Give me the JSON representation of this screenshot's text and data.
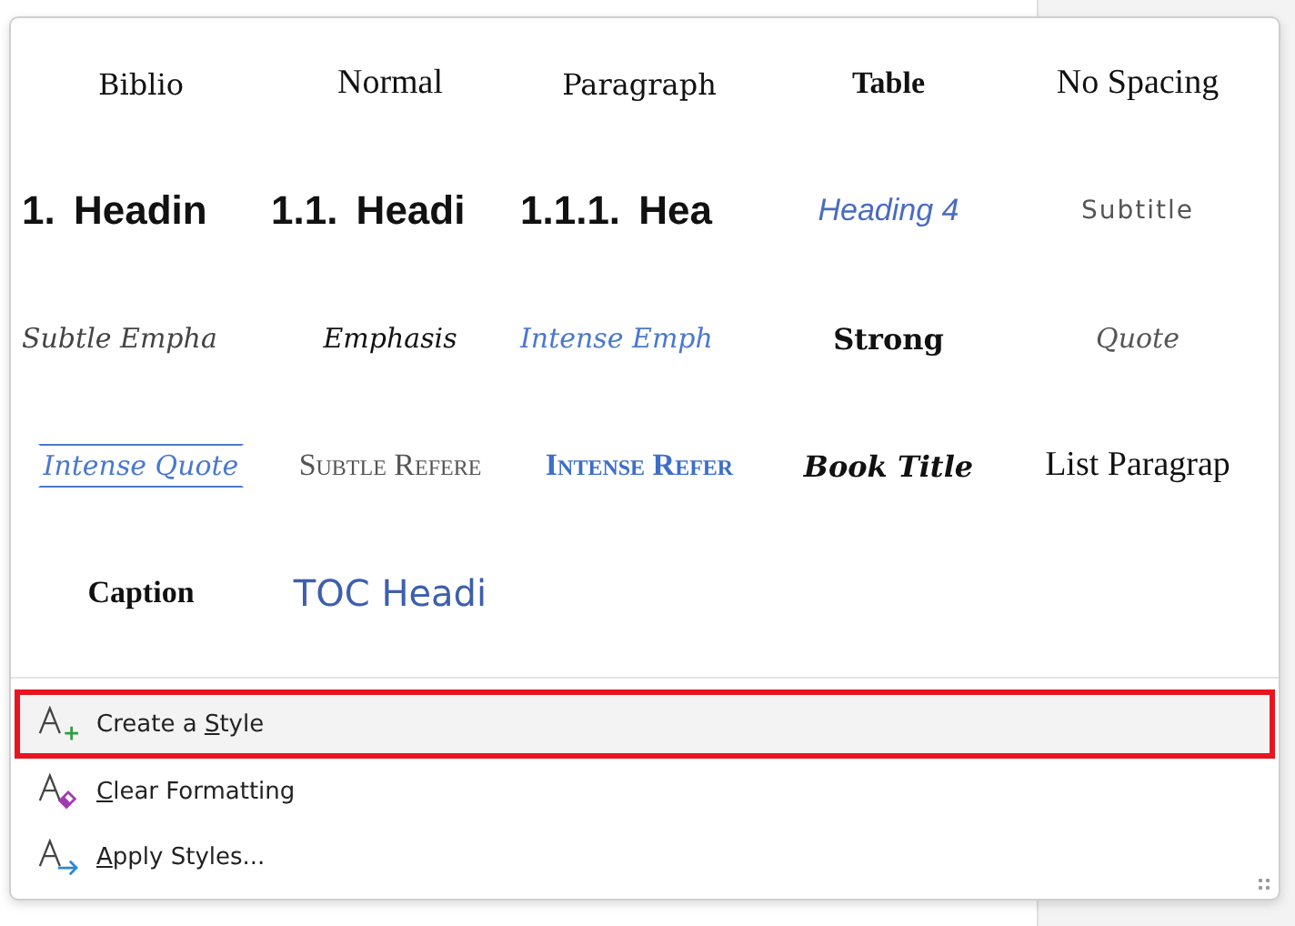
{
  "styles": [
    {
      "label": "Biblio",
      "kind": "plain",
      "selected": false
    },
    {
      "label": "Normal",
      "kind": "serif",
      "selected": false
    },
    {
      "label": "Paragraph",
      "kind": "plain",
      "selected": false
    },
    {
      "label": "Table",
      "kind": "serif-bold",
      "selected": false
    },
    {
      "label": "No Spacing",
      "kind": "serif",
      "selected": false
    },
    {
      "label": "1. Headin",
      "kind": "heading",
      "selected": false
    },
    {
      "label": "1.1. Headi",
      "kind": "heading",
      "selected": false
    },
    {
      "label": "1.1.1. Hea",
      "kind": "heading",
      "selected": false
    },
    {
      "label": "Heading 4",
      "kind": "heading4",
      "selected": false
    },
    {
      "label": "Subtitle",
      "kind": "subtitle",
      "selected": false
    },
    {
      "label": "Subtle Empha",
      "kind": "subtle-emphasis",
      "selected": false
    },
    {
      "label": "Emphasis",
      "kind": "emphasis",
      "selected": false
    },
    {
      "label": "Intense Emph",
      "kind": "intense-emphasis",
      "selected": false
    },
    {
      "label": "Strong",
      "kind": "strong",
      "selected": false
    },
    {
      "label": "Quote",
      "kind": "quote",
      "selected": false
    },
    {
      "label": "Intense Quote",
      "kind": "intense-quote",
      "selected": false
    },
    {
      "label": "Subtle Refere",
      "kind": "subtle-reference",
      "selected": false
    },
    {
      "label": "Intense Refer",
      "kind": "intense-reference",
      "selected": false
    },
    {
      "label": "Book Title",
      "kind": "book-title",
      "selected": false
    },
    {
      "label": "List Paragrap",
      "kind": "serif",
      "selected": false
    },
    {
      "label": "Caption",
      "kind": "serif-bold",
      "selected": false
    },
    {
      "label": "TOC Headi",
      "kind": "toc",
      "selected": false
    }
  ],
  "menu": [
    {
      "before": "Create a ",
      "key": "S",
      "after": "tyle",
      "kind": "create",
      "selected": true
    },
    {
      "key": "C",
      "after": "lear Formatting",
      "kind": "clear",
      "selected": false
    },
    {
      "key": "A",
      "after": "pply Styles...",
      "kind": "apply",
      "selected": false
    }
  ]
}
